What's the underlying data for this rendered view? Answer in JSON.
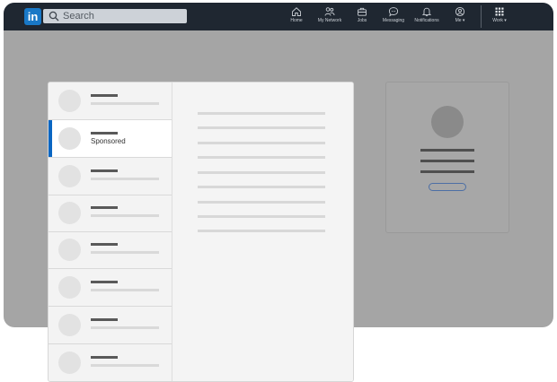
{
  "topbar": {
    "logo_text": "in",
    "search_placeholder": "Search",
    "nav": [
      {
        "id": "home",
        "label": "Home",
        "icon": "home-icon"
      },
      {
        "id": "network",
        "label": "My Network",
        "icon": "people-icon"
      },
      {
        "id": "jobs",
        "label": "Jobs",
        "icon": "briefcase-icon"
      },
      {
        "id": "messaging",
        "label": "Messaging",
        "icon": "chat-icon"
      },
      {
        "id": "notifications",
        "label": "Notifications",
        "icon": "bell-icon"
      },
      {
        "id": "me",
        "label": "Me ▾",
        "icon": "profile-icon"
      },
      {
        "id": "work",
        "label": "Work ▾",
        "icon": "grid-icon"
      }
    ]
  },
  "messages": {
    "sponsored_label": "Sponsored"
  },
  "colors": {
    "topbar": "#1f2731",
    "brand": "#1978c6",
    "active_indicator": "#0a66c2",
    "overlay": "#a5a5a5"
  }
}
